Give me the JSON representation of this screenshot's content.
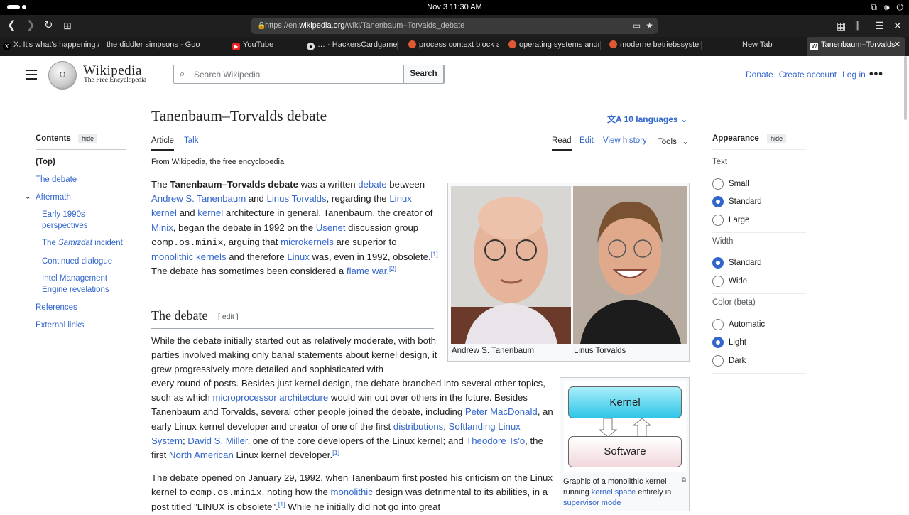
{
  "system": {
    "clock": "Nov 3  11:30 AM"
  },
  "browser": {
    "url_prefix": "https://en.",
    "url_host": "wikipedia.org",
    "url_path": "/wiki/Tanenbaum–Torvalds_debate",
    "tabs": [
      {
        "label": "X. It's what's happening /",
        "icon": "x-icon"
      },
      {
        "label": "the diddler simpsons - Googl",
        "icon": "none"
      },
      {
        "label": "YouTube",
        "icon": "youtube-icon"
      },
      {
        "label": "… · HackersCardgame/hac",
        "icon": "github-icon"
      },
      {
        "label": "process context block at D",
        "icon": "duckduckgo-icon"
      },
      {
        "label": "operating systems andrew",
        "icon": "duckduckgo-icon"
      },
      {
        "label": "moderne betriebssysteme",
        "icon": "duckduckgo-icon"
      },
      {
        "label": "New Tab",
        "icon": "none"
      },
      {
        "label": "Tanenbaum–Torvalds",
        "icon": "wikipedia-icon"
      }
    ]
  },
  "header": {
    "wordmark": "Wikipedia",
    "tagline": "The Free Encyclopedia",
    "search_placeholder": "Search Wikipedia",
    "search_button": "Search",
    "donate": "Donate",
    "create_account": "Create account",
    "login": "Log in"
  },
  "article": {
    "title": "Tanenbaum–Torvalds debate",
    "languages": "10 languages",
    "tab_article": "Article",
    "tab_talk": "Talk",
    "tab_read": "Read",
    "tab_edit": "Edit",
    "tab_history": "View history",
    "tab_tools": "Tools",
    "from": "From Wikipedia, the free encyclopedia",
    "section_heading": "The debate",
    "section_edit": "[ edit ]",
    "caption_left": "Andrew S. Tanenbaum",
    "caption_right": "Linus Torvalds",
    "diagram_top": "Kernel",
    "diagram_bottom": "Software",
    "diagram_caption_1": "Graphic of a monolithic kernel running ",
    "diagram_caption_link1": "kernel space",
    "diagram_caption_2": " entirely in ",
    "diagram_caption_link2": "supervisor mode"
  },
  "toc": {
    "title": "Contents",
    "hide": "hide",
    "items": [
      "(Top)",
      "The debate",
      "Aftermath",
      "Early 1990s perspectives",
      "The Samizdat incident",
      "Continued dialogue",
      "Intel Management Engine revelations",
      "References",
      "External links"
    ]
  },
  "appearance": {
    "title": "Appearance",
    "hide": "hide",
    "text_label": "Text",
    "text_options": [
      "Small",
      "Standard",
      "Large"
    ],
    "text_selected": "Standard",
    "width_label": "Width",
    "width_options": [
      "Standard",
      "Wide"
    ],
    "width_selected": "Standard",
    "color_label": "Color (beta)",
    "color_options": [
      "Automatic",
      "Light",
      "Dark"
    ],
    "color_selected": "Light"
  }
}
